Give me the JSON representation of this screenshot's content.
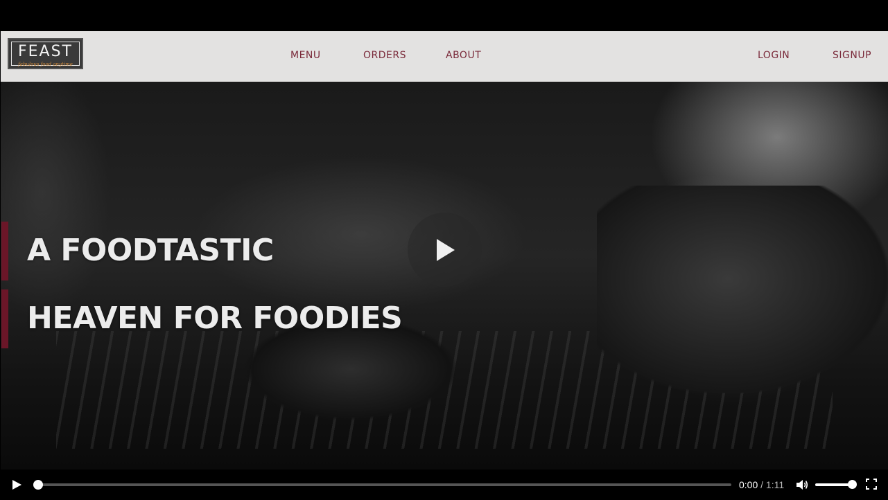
{
  "navbar": {
    "logo": {
      "name": "FEAST",
      "tagline": "fabulous food anytime"
    },
    "links": {
      "menu": "MENU",
      "orders": "ORDERS",
      "about": "ABOUT",
      "login": "LOGIN",
      "signup": "SIGNUP"
    }
  },
  "hero": {
    "headline_line1": "A FOODTASTIC",
    "headline_line2": "HEAVEN FOR FOODIES",
    "accent_color": "#6b1628",
    "play_icon": "play-icon"
  },
  "video_controls": {
    "play_icon": "play-icon",
    "current_time": "0:00",
    "separator": "/",
    "duration": "1:11",
    "progress_fraction": 0.0,
    "volume_fraction": 1.0,
    "volume_icon": "volume-icon",
    "fullscreen_icon": "fullscreen-icon"
  },
  "colors": {
    "nav_background": "#e3e2e1",
    "nav_link": "#7a2a3a",
    "logo_background": "#3a3a3a",
    "logo_tagline": "#d08a3a",
    "controls_background": "#000000"
  }
}
